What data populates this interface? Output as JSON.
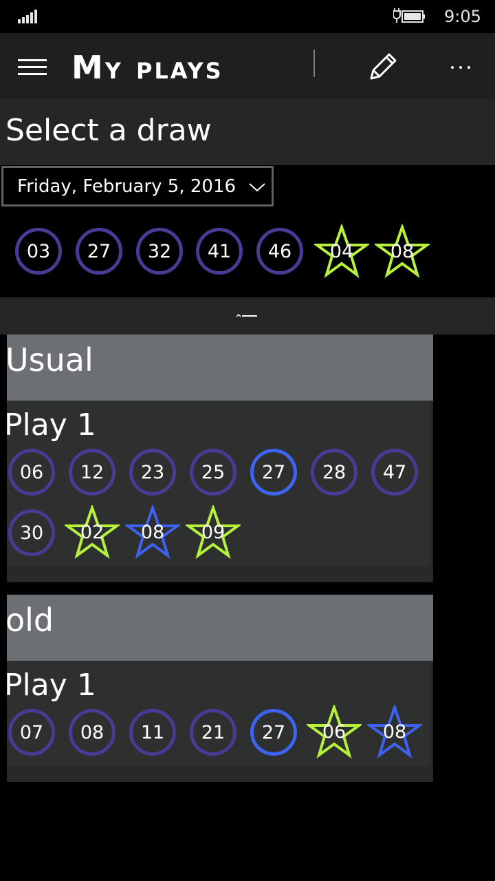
{
  "status": {
    "time": "9:05"
  },
  "app": {
    "title": "My plays",
    "menu_icon": "hamburger-icon",
    "edit_icon": "pencil-icon",
    "more_icon": "more-ellipsis-icon"
  },
  "draw": {
    "heading": "Select a draw",
    "selected_date": "Friday, February 5, 2016",
    "numbers": [
      "03",
      "27",
      "32",
      "41",
      "46"
    ],
    "stars": [
      "04",
      "08"
    ]
  },
  "colors": {
    "ball_border": "#4a3a96",
    "match_blue": "#3d63f0",
    "star_green": "#b6f23c",
    "group_header": "#6c7074"
  },
  "groups": [
    {
      "name": "Usual",
      "plays": [
        {
          "label": "Play 1",
          "numbers": [
            {
              "n": "06",
              "match": false
            },
            {
              "n": "12",
              "match": false
            },
            {
              "n": "23",
              "match": false
            },
            {
              "n": "25",
              "match": false
            },
            {
              "n": "27",
              "match": true
            },
            {
              "n": "28",
              "match": false
            },
            {
              "n": "47",
              "match": false
            },
            {
              "n": "30",
              "match": false
            }
          ],
          "stars": [
            {
              "n": "02",
              "match": false
            },
            {
              "n": "08",
              "match": true
            },
            {
              "n": "09",
              "match": false
            }
          ]
        }
      ]
    },
    {
      "name": "old",
      "plays": [
        {
          "label": "Play 1",
          "numbers": [
            {
              "n": "07",
              "match": false
            },
            {
              "n": "08",
              "match": false
            },
            {
              "n": "11",
              "match": false
            },
            {
              "n": "21",
              "match": false
            },
            {
              "n": "27",
              "match": true
            }
          ],
          "stars": [
            {
              "n": "06",
              "match": false
            },
            {
              "n": "08",
              "match": true
            }
          ]
        }
      ]
    }
  ]
}
